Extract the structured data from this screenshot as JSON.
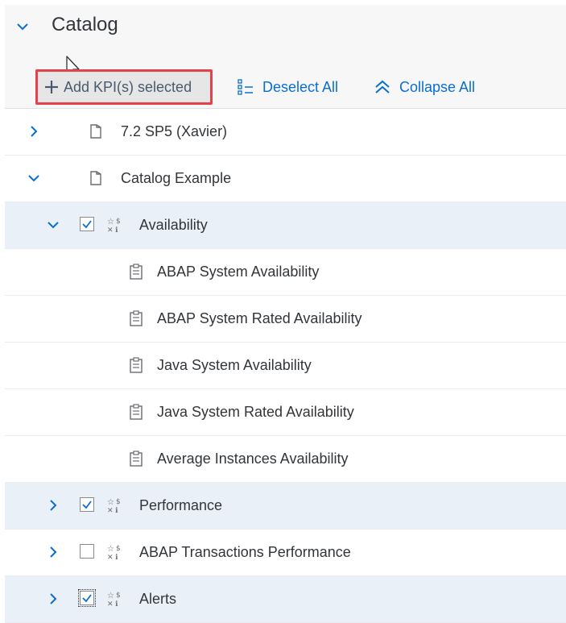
{
  "catalog": {
    "title": "Catalog"
  },
  "toolbar": {
    "add_label": "Add KPI(s) selected",
    "deselect_label": "Deselect All",
    "collapse_label": "Collapse All"
  },
  "tree": {
    "rows": [
      {
        "label": "7.2 SP5 (Xavier)",
        "level": 0,
        "expanded": false,
        "icon": "folder-icon"
      },
      {
        "label": "Catalog Example",
        "level": 0,
        "expanded": true,
        "icon": "folder-icon"
      },
      {
        "label": "Availability",
        "level": 1,
        "expanded": true,
        "checked": true,
        "icon": "kpi-group-icon",
        "selected": true
      },
      {
        "label": "ABAP System Availability",
        "level": 2,
        "icon": "clipboard-icon"
      },
      {
        "label": "ABAP System Rated Availability",
        "level": 2,
        "icon": "clipboard-icon"
      },
      {
        "label": "Java System Availability",
        "level": 2,
        "icon": "clipboard-icon"
      },
      {
        "label": "Java System Rated Availability",
        "level": 2,
        "icon": "clipboard-icon"
      },
      {
        "label": "Average Instances Availability",
        "level": 2,
        "icon": "clipboard-icon"
      },
      {
        "label": "Performance",
        "level": 1,
        "expanded": false,
        "checked": true,
        "icon": "kpi-group-icon",
        "selected": true
      },
      {
        "label": "ABAP Transactions Performance",
        "level": 1,
        "expanded": false,
        "checked": false,
        "icon": "kpi-group-icon"
      },
      {
        "label": "Alerts",
        "level": 1,
        "expanded": false,
        "checked": true,
        "icon": "kpi-group-icon",
        "selected": true
      }
    ]
  },
  "colors": {
    "accent": "#0a6ed1",
    "highlight_border": "#e4414a",
    "selected_row": "#eaf0f7"
  }
}
